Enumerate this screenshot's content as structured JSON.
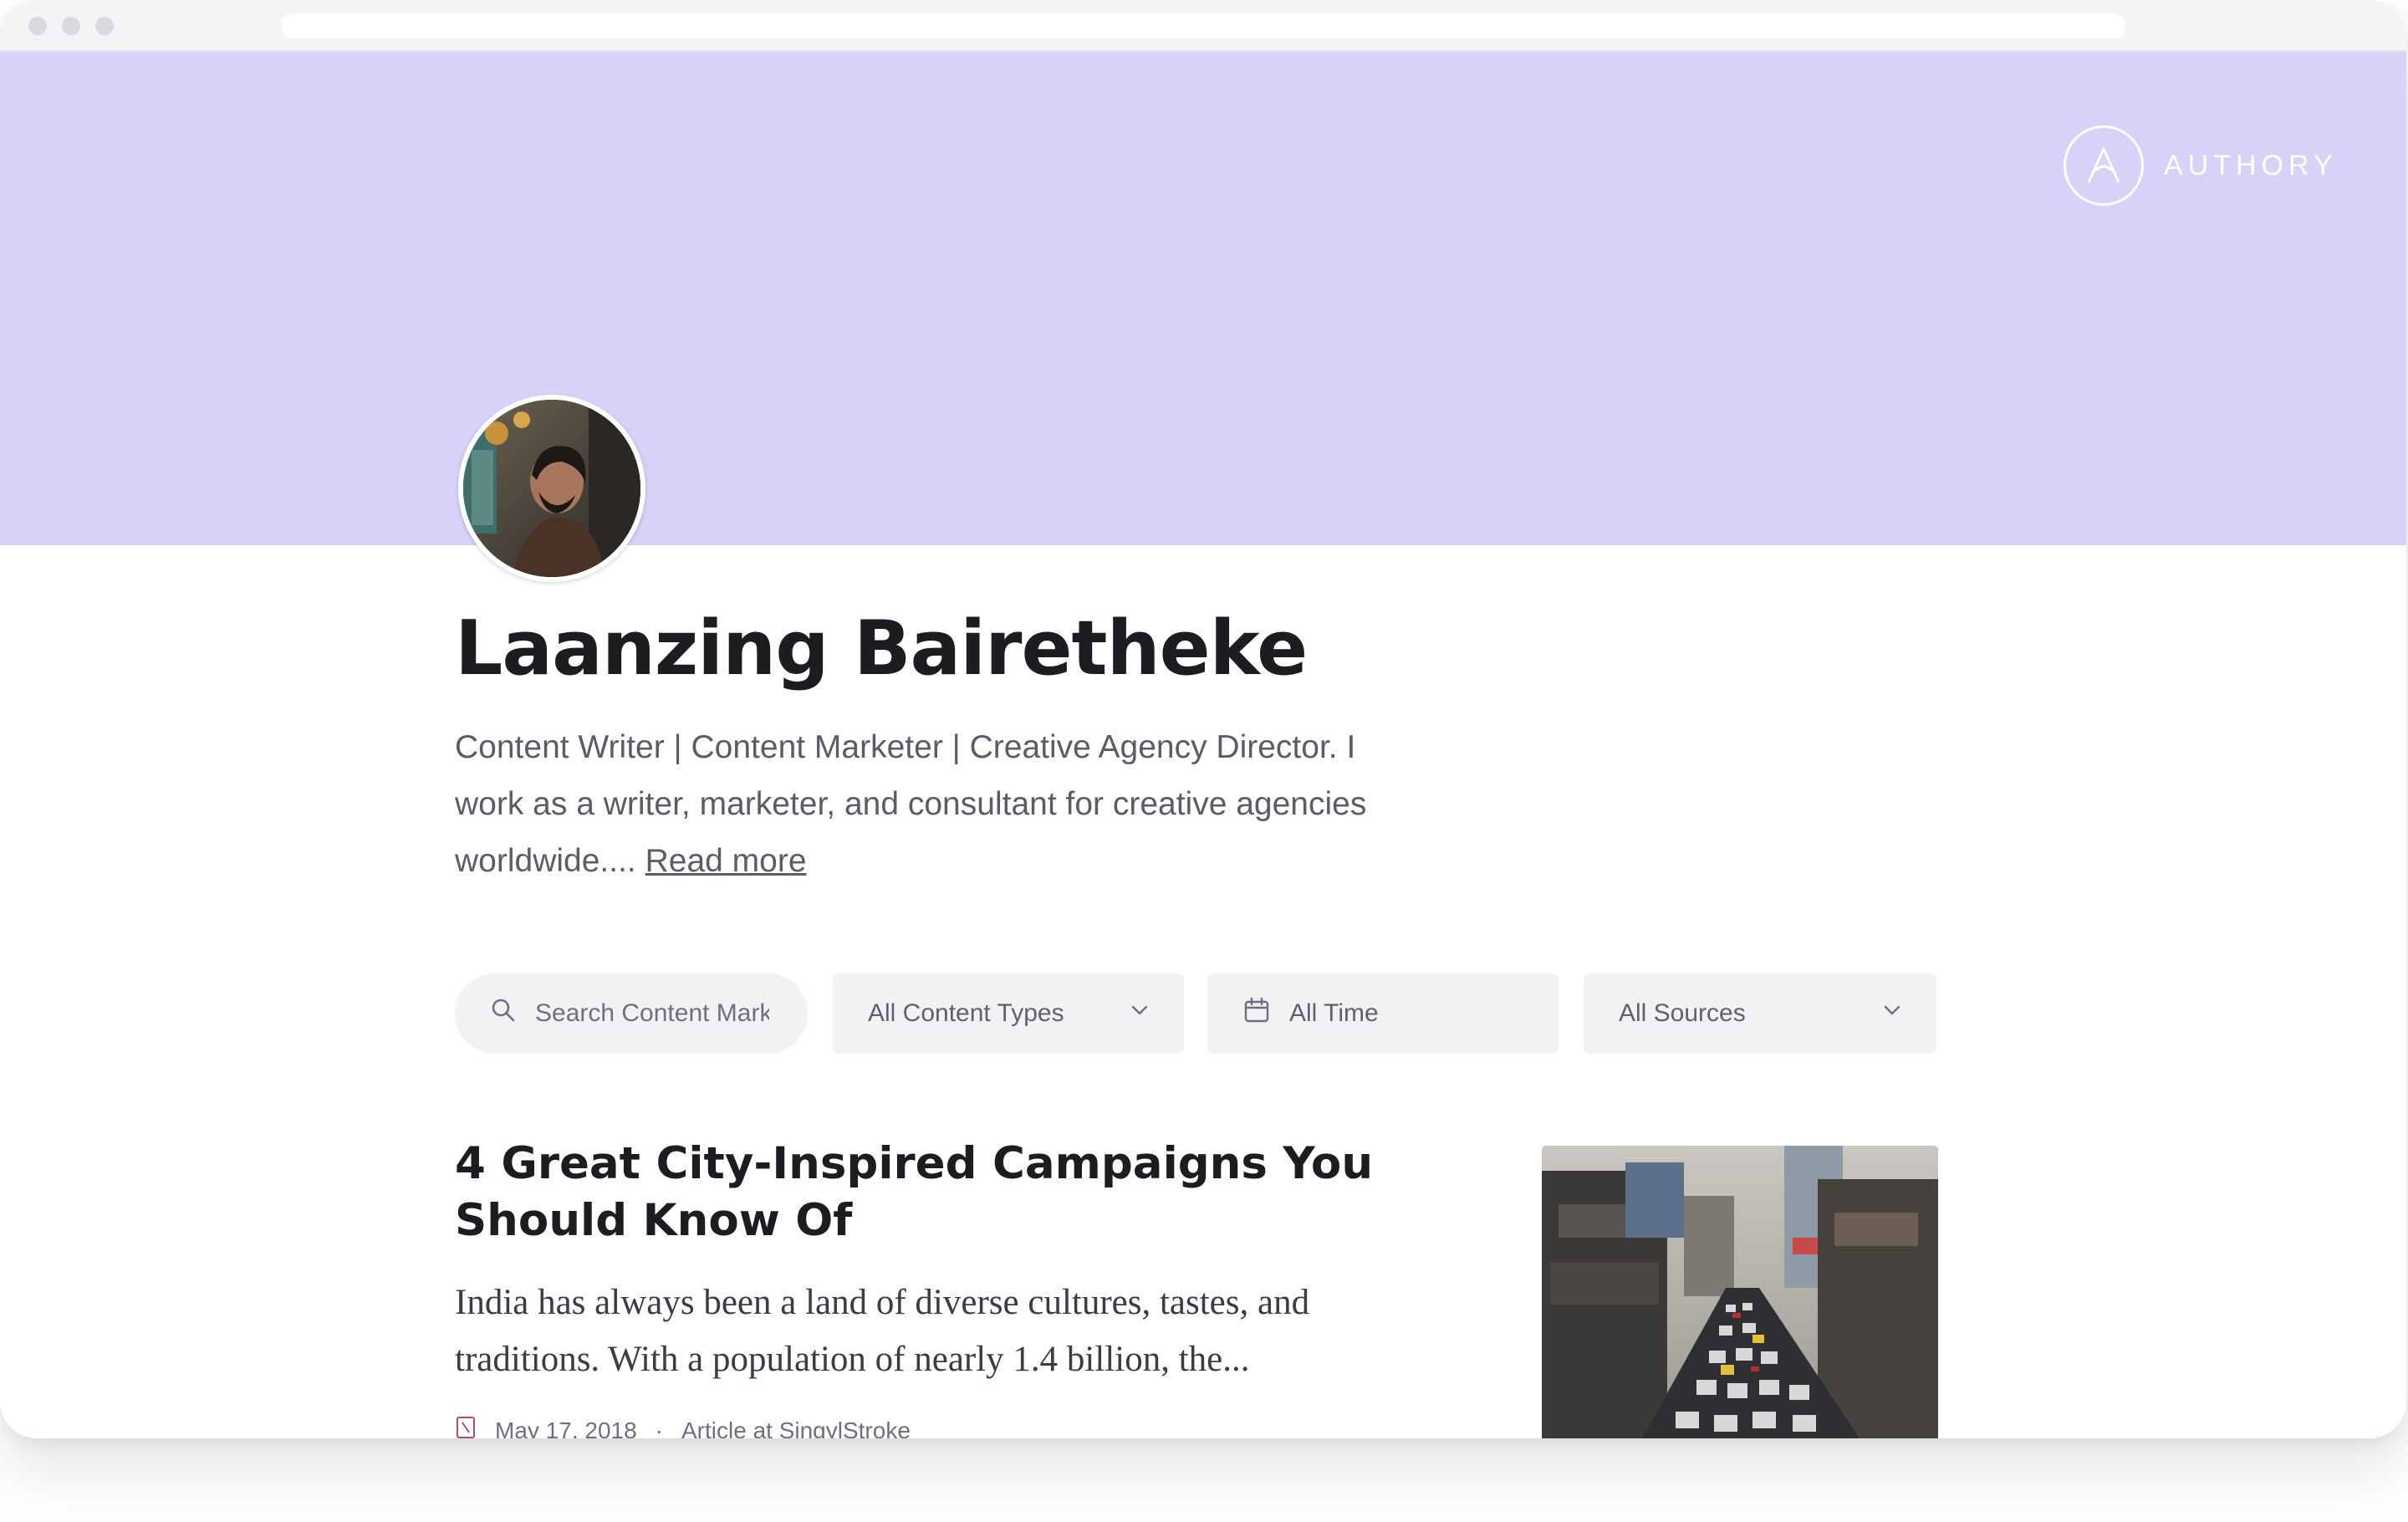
{
  "brand": {
    "name": "AUTHORY",
    "logo_icon": "authory-a-logo-icon"
  },
  "profile": {
    "name": "Laanzing Bairetheke",
    "bio": "Content Writer | Content Marketer | Creative Agency Director. I work as a writer, marketer, and consultant for creative agencies worldwide....",
    "read_more": "Read more",
    "avatar_icon": "avatar-photo"
  },
  "filters": {
    "search_placeholder": "Search Content Marketing",
    "search_icon": "search-icon",
    "content_types": "All Content Types",
    "time_range": "All Time",
    "time_icon": "calendar-icon",
    "sources": "All Sources",
    "chevron_icon": "chevron-down-icon"
  },
  "articles": [
    {
      "title": "4 Great City-Inspired Campaigns You Should Know Of",
      "excerpt": "India has always been a land of diverse cultures, tastes, and traditions. With a population of nearly 1.4 billion, the...",
      "date": "May 17, 2018",
      "separator": "·",
      "source": "Article at SingylStroke",
      "type_icon": "article-icon",
      "thumbnail_icon": "city-traffic-photo"
    }
  ],
  "colors": {
    "banner": "#d6d2f8",
    "heading": "#1d1d21",
    "body_text": "#5a5d66",
    "filter_bg": "#f2f2f5"
  }
}
